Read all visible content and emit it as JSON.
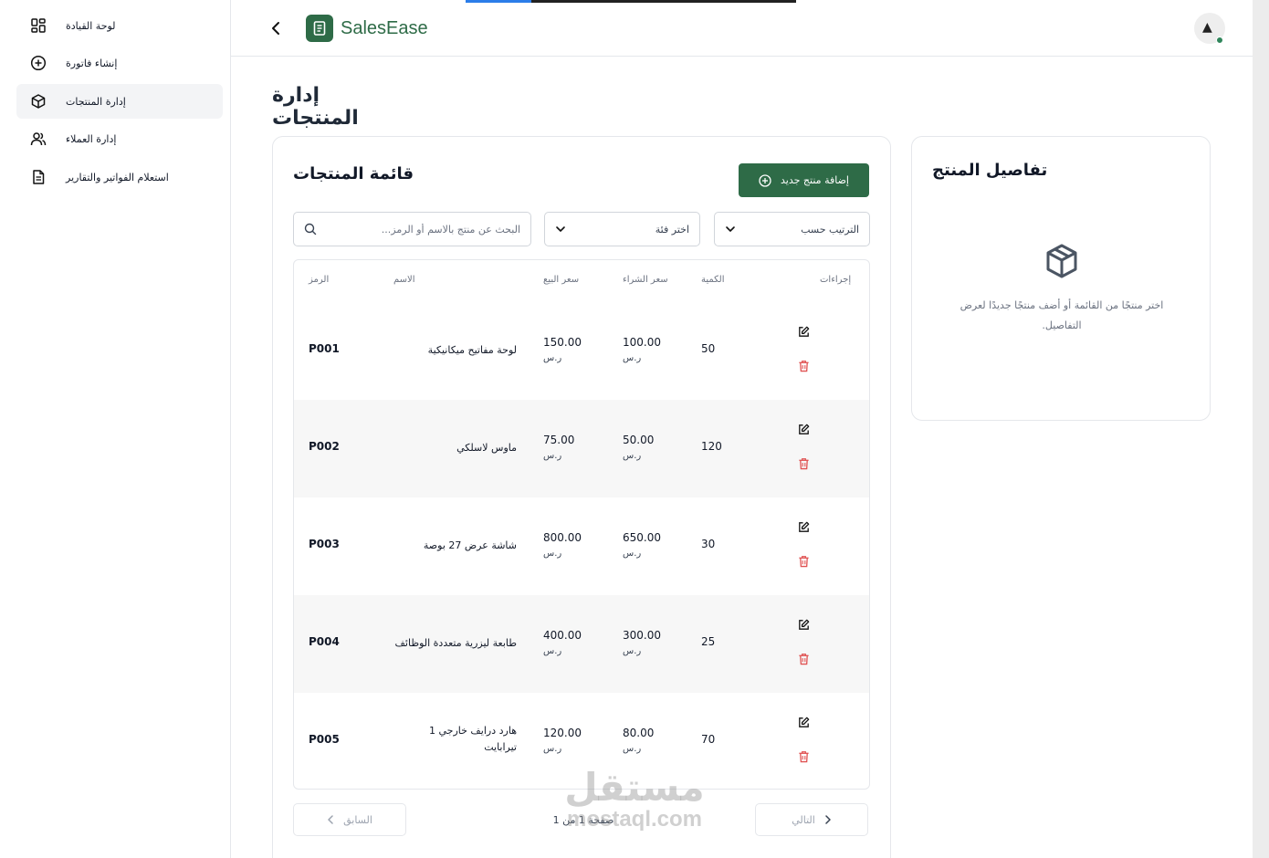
{
  "app": {
    "name": "SalesEase"
  },
  "sidebar": {
    "items": [
      {
        "label": "لوحة القيادة",
        "icon": "dashboard-icon",
        "active": false
      },
      {
        "label": "إنشاء فاتورة",
        "icon": "plus-circle-icon",
        "active": false
      },
      {
        "label": "إدارة المنتجات",
        "icon": "box-icon",
        "active": true
      },
      {
        "label": "إدارة العملاء",
        "icon": "users-icon",
        "active": false
      },
      {
        "label": "استعلام الفواتير والتقارير",
        "icon": "document-icon",
        "active": false
      }
    ]
  },
  "page": {
    "title": "إدارة المنتجات"
  },
  "list": {
    "title": "قائمة المنتجات",
    "add_button": "إضافة منتج جديد",
    "search_placeholder": "البحث عن منتج بالاسم أو الرمز...",
    "category_select": "اختر فئة",
    "sort_select": "الترتيب حسب",
    "columns": {
      "code": "الرمز",
      "name": "الاسم",
      "sell_price": "سعر البيع",
      "buy_price": "سعر الشراء",
      "qty": "الكمية",
      "actions": "إجراءات"
    },
    "currency": "ر.س",
    "rows": [
      {
        "code": "P001",
        "name": "لوحة مفاتيح ميكانيكية",
        "sell": "150.00",
        "buy": "100.00",
        "qty": "50"
      },
      {
        "code": "P002",
        "name": "ماوس لاسلكي",
        "sell": "75.00",
        "buy": "50.00",
        "qty": "120"
      },
      {
        "code": "P003",
        "name": "شاشة عرض 27 بوصة",
        "sell": "800.00",
        "buy": "650.00",
        "qty": "30"
      },
      {
        "code": "P004",
        "name": "طابعة ليزرية متعددة الوظائف",
        "sell": "400.00",
        "buy": "300.00",
        "qty": "25"
      },
      {
        "code": "P005",
        "name": "هارد درايف خارجي 1 تيرابايت",
        "sell": "120.00",
        "buy": "80.00",
        "qty": "70"
      }
    ],
    "pagination": {
      "prev": "السابق",
      "next": "التالي",
      "info": "صفحة 1 من 1"
    }
  },
  "details": {
    "title": "تفاصيل المنتج",
    "empty_text": "اختر منتجًا من القائمة أو أضف منتجًا جديدًا لعرض التفاصيل."
  },
  "watermark": {
    "arabic": "مستقل",
    "latin": "mostaql.com"
  },
  "colors": {
    "primary": "#2e6b47",
    "danger": "#e05252",
    "accent_bar": "#2b7de9"
  }
}
